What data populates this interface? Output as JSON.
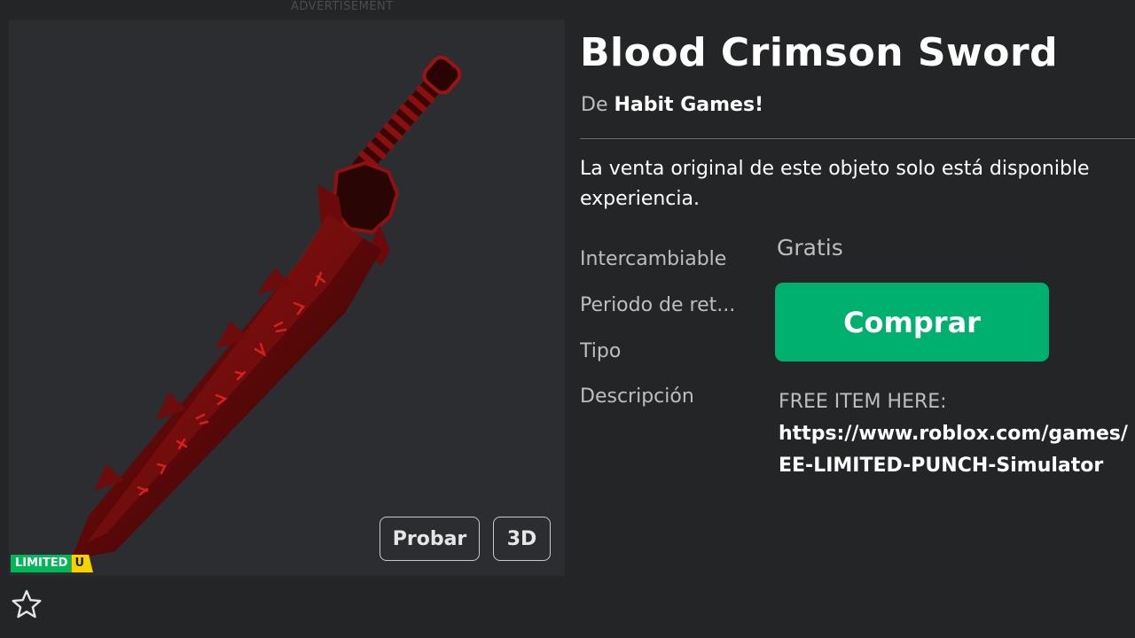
{
  "ad": {
    "label": "ADVERTISEMENT"
  },
  "item": {
    "title": "Blood Crimson Sword",
    "creator_prefix": "De",
    "creator_name": "Habit Games!",
    "sale_note_line1": "La venta original de este objeto solo está disponible",
    "sale_note_line2": "experiencia.",
    "badge_limited": "LIMITED",
    "badge_unique": "U"
  },
  "viewer": {
    "try_on_label": "Probar",
    "view_3d_label": "3D"
  },
  "fields": {
    "tradable_label": "Intercambiable",
    "hold_period_label": "Periodo de ret...",
    "type_label": "Tipo",
    "description_label": "Descripción"
  },
  "purchase": {
    "price": "Gratis",
    "buy_label": "Comprar"
  },
  "description": {
    "line1": "FREE ITEM HERE:",
    "line2": "https://www.roblox.com/games/",
    "line3": "EE-LIMITED-PUNCH-Simulator"
  },
  "icons": {
    "favorite": "star-outline-icon"
  },
  "colors": {
    "background": "#232527",
    "thumbnail_bg": "#2b2d30",
    "buy_button": "#00b06f",
    "limited_green": "#02b757",
    "limited_yellow": "#f8d100",
    "sword_red": "#7a0c0c"
  }
}
